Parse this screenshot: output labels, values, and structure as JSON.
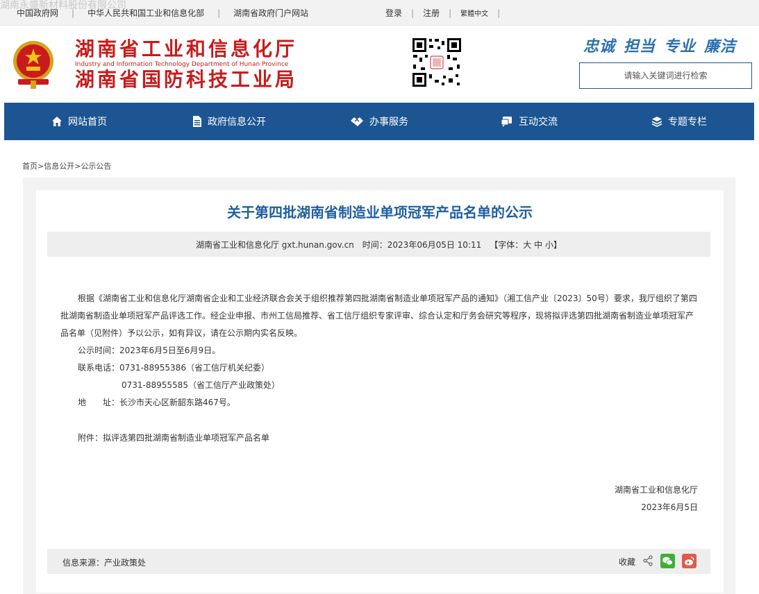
{
  "watermark": "湖南永盛新材料股份有限公司",
  "topbar": {
    "links": [
      "中国政府网",
      "中华人民共和国工业和信息化部",
      "湖南省政府门户网站"
    ],
    "login": "登录",
    "register": "注册",
    "lang": "繁體中文"
  },
  "header": {
    "title_cn_1": "湖南省工业和信息化厅",
    "title_en": "Industry and Information Technology Department of Hunan Province",
    "title_cn_2": "湖南省国防科技工业局",
    "slogans": [
      "忠诚",
      "担当",
      "专业",
      "廉洁"
    ],
    "search_placeholder": "请输入关键词进行检索"
  },
  "nav": {
    "items": [
      {
        "label": "网站首页",
        "icon": "home-icon"
      },
      {
        "label": "政府信息公开",
        "icon": "document-icon"
      },
      {
        "label": "办事服务",
        "icon": "handshake-icon"
      },
      {
        "label": "互动交流",
        "icon": "chat-icon"
      },
      {
        "label": "专题专栏",
        "icon": "layers-icon"
      }
    ]
  },
  "breadcrumb": {
    "items": [
      "首页",
      "信息公开",
      "公示公告"
    ],
    "separator": ">"
  },
  "article": {
    "title": "关于第四批湖南省制造业单项冠军产品名单的公示",
    "meta_source": "湖南省工业和信息化厅 gxt.hunan.gov.cn",
    "meta_time": "时间：2023年06月05日 10:11",
    "meta_font_label": "【字体：",
    "font_sizes": [
      "大",
      "中",
      "小"
    ],
    "meta_font_end": "】",
    "paragraph": "根据《湖南省工业和信息化厅湖南省企业和工业经济联合会关于组织推荐第四批湖南省制造业单项冠军产品的通知》（湘工信产业〔2023〕50号）要求，我厅组织了第四批湖南省制造业单项冠军产品评选工作。经企业申报、市州工信局推荐、省工信厅组织专家评审、综合认定和厅务会研究等程序，现将拟评选第四批湖南省制造业单项冠军产品名单（见附件）予以公示，如有异议，请在公示期内实名反映。",
    "public_period": "公示时间：2023年6月5日至6月9日。",
    "phone_1": "联系电话：0731-88955386（省工信厅机关纪委）",
    "phone_2": "0731-88955585（省工信厅产业政策处）",
    "address": "地　　址：长沙市天心区新韶东路467号。",
    "attachment": "附件：拟评选第四批湖南省制造业单项冠军产品名单",
    "signer": "湖南省工业和信息化厅",
    "sign_date": "2023年6月5日"
  },
  "footer": {
    "source": "信息来源：产业政策处",
    "favorite": "收藏"
  },
  "colors": {
    "brand_blue": "#1c5592",
    "title_red": "#c81b1b",
    "title_blue": "#1f5fa0"
  }
}
